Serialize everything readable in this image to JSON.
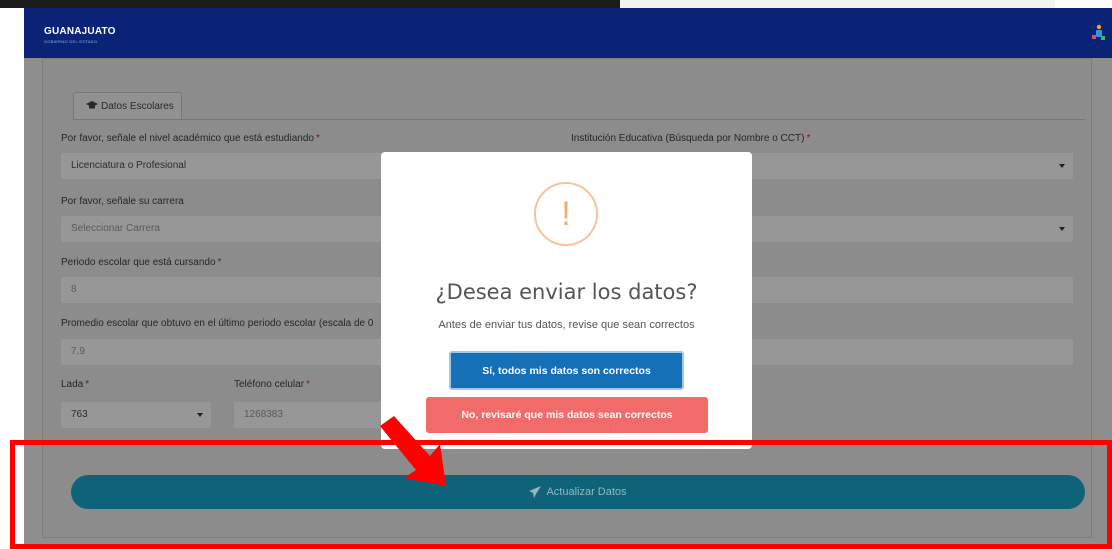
{
  "navbar": {
    "brand": "GUANAJUATO",
    "brand_sub": "GOBIERNO DEL ESTADO"
  },
  "form": {
    "tab_label": "Datos Escolares",
    "nivel": {
      "label": "Por favor, señale el nivel académico que está estudiando",
      "value": "Licenciatura o Profesional"
    },
    "institucion": {
      "label": "Institución Educativa (Búsqueda por Nombre o CCT)"
    },
    "carrera": {
      "label": "Por favor, señale su carrera",
      "placeholder": "Seleccionar Carrera"
    },
    "periodo": {
      "label": "Periodo escolar que está cursando",
      "value": "8"
    },
    "promedio": {
      "label": "Promedio escolar que obtuvo en el último periodo escolar (escala de 0",
      "value": "7.9"
    },
    "lada": {
      "label": "Lada",
      "value": "763"
    },
    "telefono": {
      "label": "Teléfono celular",
      "value": "1268383"
    },
    "required_mark": "*",
    "submit_label": "Actualizar Datos"
  },
  "modal": {
    "icon_glyph": "!",
    "title": "¿Desea enviar los datos?",
    "text": "Antes de enviar tus datos, revise que sean correctos",
    "confirm_label": "Sí, todos mis datos son correctos",
    "cancel_label": "No, revisaré que mis datos sean correctos"
  },
  "colors": {
    "navbar": "#0b2376",
    "action_button": "#0f6378",
    "confirm_button": "#1570b7",
    "cancel_button": "#f16b6b",
    "warning_icon": "#f8c39a",
    "highlight_box": "#ff0000"
  },
  "icons": {
    "tab": "graduation-cap-icon",
    "submit": "paper-plane-icon",
    "modal": "warning-icon",
    "navbar_right": "user-icon",
    "annotation": "red-arrow-icon"
  }
}
